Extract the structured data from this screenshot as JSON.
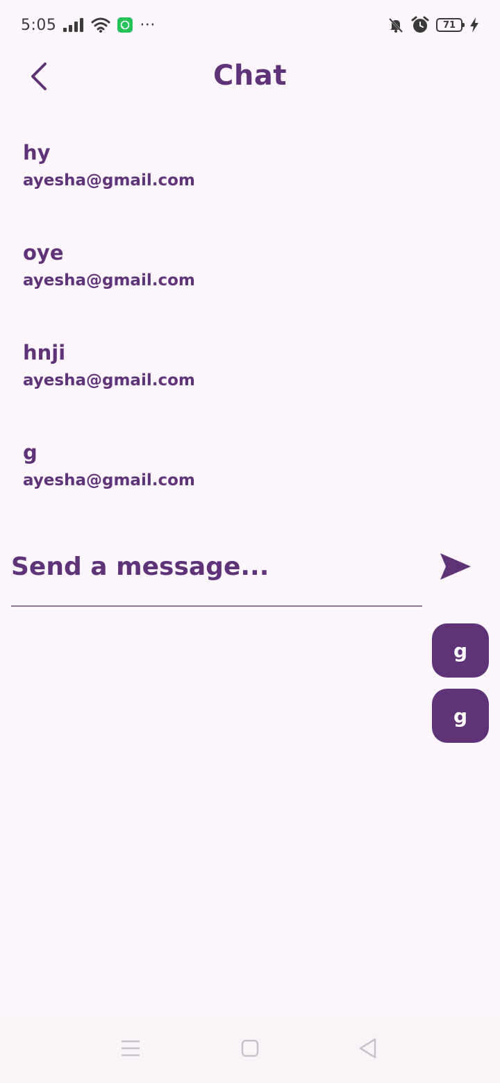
{
  "status_bar": {
    "time": "5:05",
    "overflow": "···",
    "battery_level": "71",
    "icons": [
      "signal-icon",
      "wifi-icon",
      "chat-app-icon",
      "bell-off-icon",
      "alarm-icon",
      "battery-icon",
      "charging-icon"
    ]
  },
  "header": {
    "title": "Chat",
    "back_icon": "chevron-left-icon"
  },
  "messages": [
    {
      "text": "hy",
      "sender": "ayesha@gmail.com"
    },
    {
      "text": "oye",
      "sender": "ayesha@gmail.com"
    },
    {
      "text": "hnji",
      "sender": "ayesha@gmail.com"
    },
    {
      "text": "g",
      "sender": "ayesha@gmail.com"
    }
  ],
  "composer": {
    "placeholder": "Send a message...",
    "value": "",
    "send_icon": "send-icon"
  },
  "bubbles": [
    {
      "text": "g"
    },
    {
      "text": "g"
    }
  ],
  "nav_bar": {
    "icons": [
      "menu-icon",
      "home-icon",
      "back-triangle-icon"
    ]
  },
  "colors": {
    "primary": "#5e3378",
    "background": "#fdf6fd",
    "bubble_text": "#ffffff"
  }
}
